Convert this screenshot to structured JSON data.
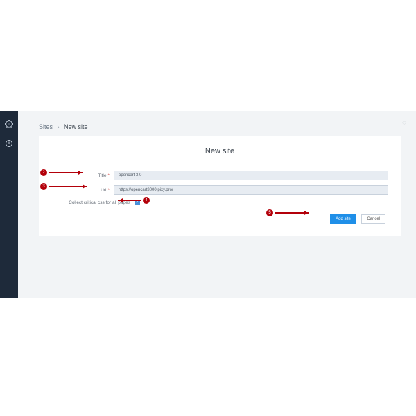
{
  "breadcrumb": {
    "parent": "Sites",
    "current": "New site"
  },
  "heading": "New site",
  "form": {
    "title_label": "Title",
    "title_value": "opencart 3.0",
    "url_label": "Url",
    "url_value": "https://opencart3000.pixy.pro/",
    "checkbox_label": "Collect critical css for all pages",
    "buttons": {
      "submit": "Add site",
      "cancel": "Cancel"
    }
  },
  "badges": {
    "b2": "2",
    "b3": "3",
    "b4": "4",
    "b5": "5"
  }
}
